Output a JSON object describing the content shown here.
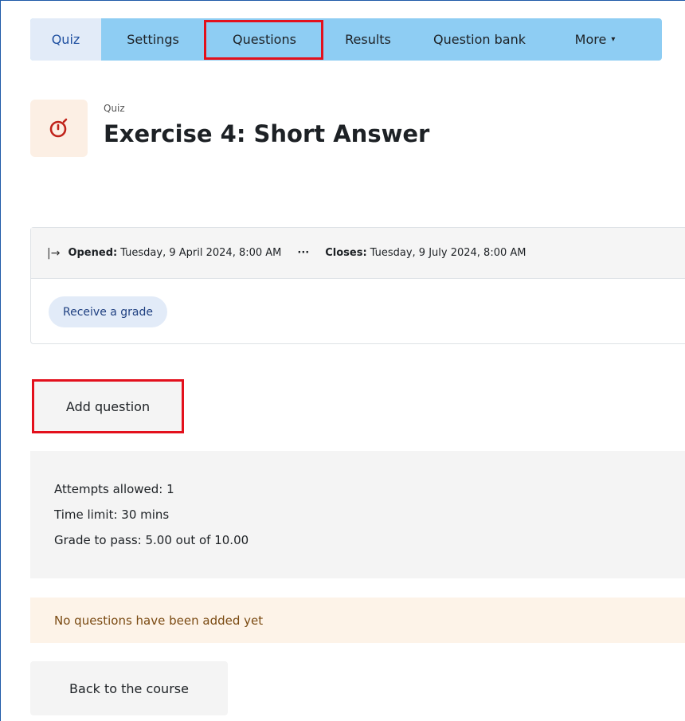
{
  "tabs": [
    {
      "label": "Quiz"
    },
    {
      "label": "Settings"
    },
    {
      "label": "Questions"
    },
    {
      "label": "Results"
    },
    {
      "label": "Question bank"
    },
    {
      "label": "More"
    }
  ],
  "header": {
    "activity_type": "Quiz",
    "title": "Exercise 4: Short Answer",
    "icon": "stopwatch-icon"
  },
  "dates": {
    "opened_label": "Opened:",
    "opened_value": "Tuesday, 9 April 2024, 8:00 AM",
    "separator": "···",
    "closes_label": "Closes:",
    "closes_value": "Tuesday, 9 July 2024, 8:00 AM"
  },
  "completion": {
    "label": "Receive a grade"
  },
  "add_question_label": "Add question",
  "info": {
    "attempts": "Attempts allowed: 1",
    "time_limit": "Time limit: 30 mins",
    "grade_to_pass": "Grade to pass: 5.00 out of 10.00"
  },
  "alert": {
    "text": "No questions have been added yet"
  },
  "back_button_label": "Back to the course",
  "colors": {
    "nav_bg": "#8ecdf3",
    "active_tab_bg": "#e2ebf8",
    "highlight": "#e3101c",
    "alert_bg": "#fdf3e8"
  }
}
